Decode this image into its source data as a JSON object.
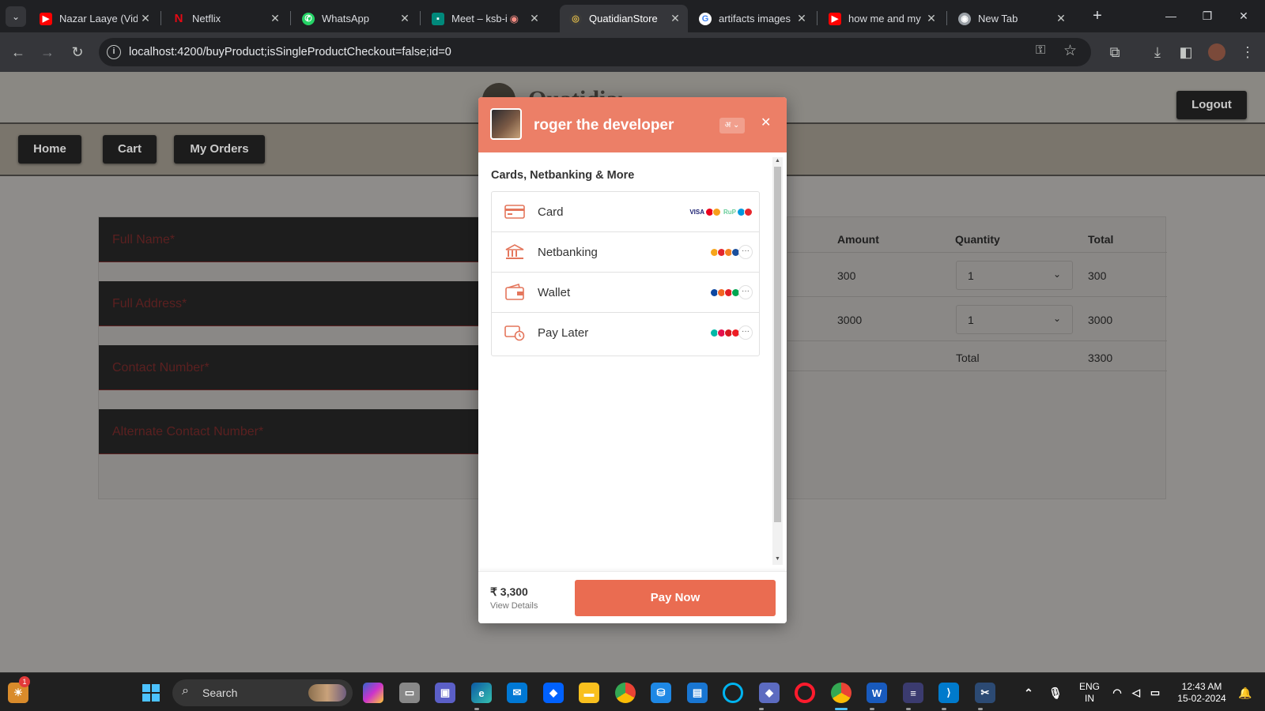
{
  "browser": {
    "tabs": [
      {
        "title": "Nazar Laaye (Vid",
        "icon_color": "#ff0000",
        "icon": "youtube-icon"
      },
      {
        "title": "Netflix",
        "icon_color": "#e50914",
        "icon": "netflix-icon"
      },
      {
        "title": "WhatsApp",
        "icon_color": "#25d366",
        "icon": "whatsapp-icon"
      },
      {
        "title": "Meet – ksb-i",
        "icon_color": "#00897b",
        "icon": "meet-icon"
      },
      {
        "title": "QuatidianStore",
        "icon_color": "#b28b1c",
        "icon": "store-icon"
      },
      {
        "title": "artifacts images",
        "icon_color": "#4285f4",
        "icon": "google-icon"
      },
      {
        "title": "how me and my",
        "icon_color": "#ff0000",
        "icon": "youtube-icon"
      },
      {
        "title": "New Tab",
        "icon_color": "#9aa0a6",
        "icon": "chrome-icon"
      }
    ],
    "url": "localhost:4200/buyProduct;isSingleProductCheckout=false;id=0"
  },
  "app": {
    "brand": "QuatidianStore",
    "logout_label": "Logout",
    "nav": [
      "Home",
      "Cart",
      "My Orders"
    ],
    "form": {
      "full_name_placeholder": "Full Name*",
      "full_address_placeholder": "Full Address*",
      "contact_placeholder": "Contact Number*",
      "alt_contact_placeholder": "Alternate Contact Number*"
    },
    "table": {
      "headers": [
        "Amount",
        "Quantity",
        "Total"
      ],
      "rows": [
        {
          "amount": "300",
          "quantity": "1",
          "total": "300"
        },
        {
          "amount": "3000",
          "quantity": "1",
          "total": "3000"
        }
      ],
      "total_label": "Total",
      "grand_total": "3300"
    }
  },
  "checkout": {
    "merchant": "roger the developer",
    "section_title": "Cards, Netbanking & More",
    "methods": [
      {
        "label": "Card",
        "icon": "card-icon"
      },
      {
        "label": "Netbanking",
        "icon": "bank-icon"
      },
      {
        "label": "Wallet",
        "icon": "wallet-icon"
      },
      {
        "label": "Pay Later",
        "icon": "paylater-icon"
      }
    ],
    "amount": "₹ 3,300",
    "view_details": "View Details",
    "pay_label": "Pay Now",
    "accent_color": "#ec7f67"
  },
  "taskbar": {
    "search_label": "Search",
    "lang_line1": "ENG",
    "lang_line2": "IN",
    "time": "12:43 AM",
    "date": "15-02-2024",
    "notification_count": "1"
  }
}
